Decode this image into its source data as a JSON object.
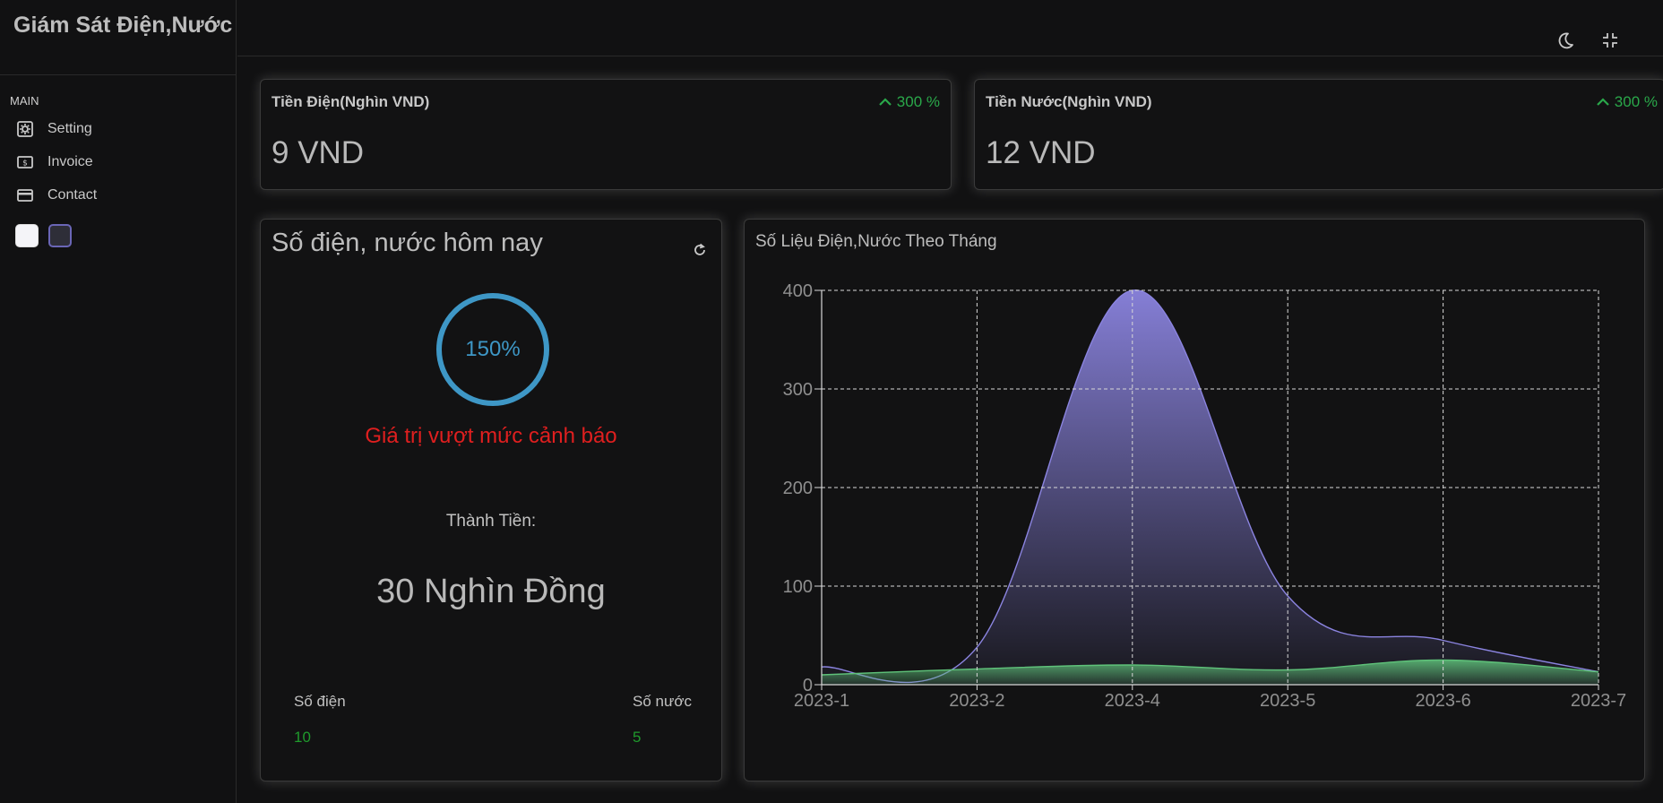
{
  "app": {
    "title": "Giám Sát Điện,Nước"
  },
  "sidebar": {
    "section": "MAIN",
    "items": [
      {
        "label": "Setting",
        "icon": "settings-icon"
      },
      {
        "label": "Invoice",
        "icon": "invoice-icon"
      },
      {
        "label": "Contact",
        "icon": "contact-card-icon"
      }
    ],
    "theme_swatches": [
      {
        "name": "light",
        "color": "#f4f4f8"
      },
      {
        "name": "dark",
        "color": "#2e2e38"
      }
    ]
  },
  "topbar": {
    "icons": [
      "moon-icon",
      "exit-fullscreen-icon"
    ]
  },
  "stats": {
    "electric": {
      "title": "Tiền Điện(Nghìn VND)",
      "change": "300 %",
      "value": "9 VND"
    },
    "water": {
      "title": "Tiền Nước(Nghìn VND)",
      "change": "300 %",
      "value": "12 VND"
    }
  },
  "today": {
    "title": "Số điện, nước hôm nay",
    "gauge_text": "150%",
    "gauge_value": 150,
    "warning": "Giá trị vượt mức cảnh báo",
    "total_label": "Thành Tiền:",
    "total_value": "30 Nghìn Đồng",
    "electric_label": "Số điện",
    "electric_value": "10",
    "water_label": "Số nước",
    "water_value": "5"
  },
  "colors": {
    "accent": "#3e97c6",
    "warning": "#e01f1f",
    "positive": "#2aa84a",
    "series_electric": "#8b84e0",
    "series_water": "#5fc27a"
  },
  "chart_data": {
    "type": "area",
    "title": "Số Liệu Điện,Nước Theo Tháng",
    "x": [
      "2023-1",
      "2023-2",
      "2023-4",
      "2023-5",
      "2023-6",
      "2023-7"
    ],
    "ylim": [
      0,
      400
    ],
    "yticks": [
      0,
      100,
      200,
      300,
      400
    ],
    "grid": true,
    "series": [
      {
        "values": [
          18,
          38,
          400,
          90,
          45,
          13
        ]
      },
      {
        "values": [
          10,
          16,
          20,
          15,
          25,
          13
        ]
      }
    ]
  }
}
